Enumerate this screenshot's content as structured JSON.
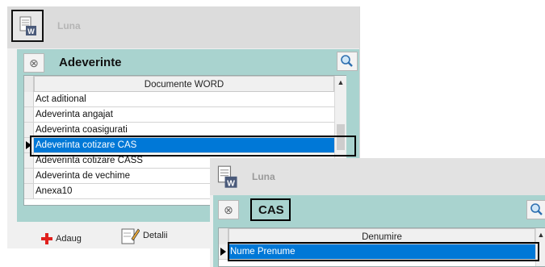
{
  "window_main": {
    "title": "Luna",
    "header_title": "Adeverinte",
    "grid": {
      "column_header": "Documente WORD",
      "rows": [
        "Act aditional",
        "Adeverinta angajat",
        "Adeverinta coasigurati",
        "Adeverinta cotizare  CAS",
        "Adeverinta cotizare CASS",
        "Adeverinta de vechime",
        "Anexa10"
      ],
      "selected_row": "Adeverinta cotizare  CAS"
    },
    "buttons": {
      "add_label": "Adaug",
      "details_label": "Detalii"
    }
  },
  "window_popup": {
    "title": "Luna",
    "header_title": "CAS",
    "grid": {
      "column_header": "Denumire",
      "rows": [
        "Nume Prenume"
      ],
      "selected_row": "Nume Prenume"
    }
  },
  "colors": {
    "panel": "#a9d3cf",
    "selection": "#0078d7",
    "add_icon": "#e0201d"
  },
  "icons": [
    "word-document-icon",
    "close-icon",
    "search-icon",
    "plus-icon",
    "details-pencil-icon",
    "scroll-up-icon",
    "row-pointer-icon"
  ]
}
